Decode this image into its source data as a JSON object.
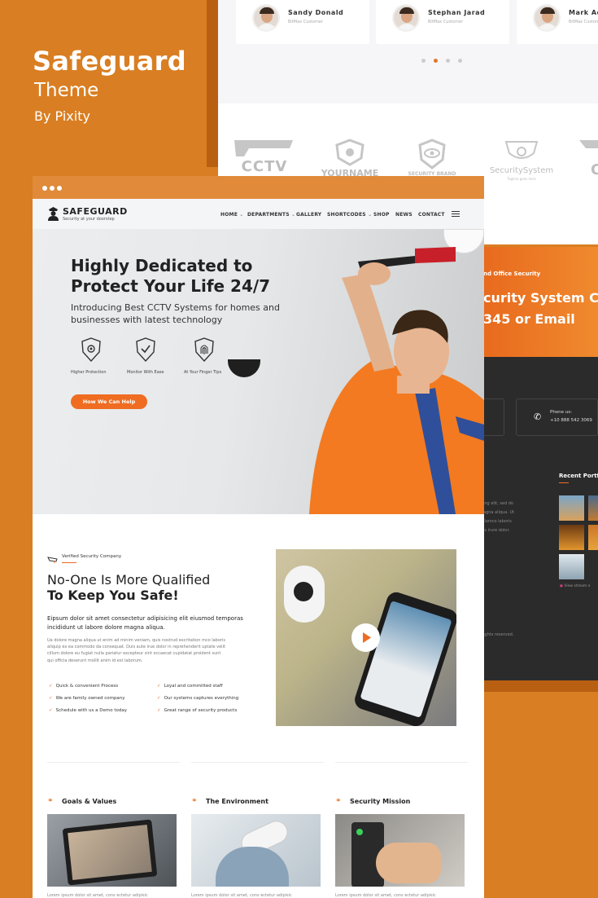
{
  "brand": {
    "title": "Safeguard",
    "subtitle": "Theme",
    "by": "By Pixity"
  },
  "testimonials": [
    {
      "name": "Sandy Donald",
      "role": "BitMax Customer"
    },
    {
      "name": "Stephan Jarad",
      "role": "BitMax Customer"
    },
    {
      "name": "Mark Ada",
      "role": "BitMax Customer"
    }
  ],
  "partner_logos": [
    "CCTV",
    "YOURNAME",
    "SECURITY BRAND",
    "SecuritySystem",
    "C"
  ],
  "partner_logo_sub": "Tagline goes here",
  "dark_panel": {
    "kicker": "nd Office Security",
    "headline1": "curity System Co",
    "headline2": "345 or Email",
    "phone_label": "Phone us:",
    "phone_number": "+10 888 542 3069",
    "recent": "Recent Portf",
    "body_lines": [
      "ing elit, sed do",
      "agna aliqua. Ut",
      "llamco laboris",
      "is irure dolor."
    ],
    "view_stream": "View stream o",
    "rights": "ights reserved."
  },
  "site": {
    "logo": "SAFEGUARD",
    "tagline": "Security at your doorstep",
    "nav": [
      "HOME",
      "DEPARTMENTS",
      "GALLERY",
      "SHORTCODES",
      "SHOP",
      "NEWS",
      "CONTACT"
    ]
  },
  "hero": {
    "title_line1": "Highly Dedicated to",
    "title_line2": "Protect Your Life 24/7",
    "desc_line1": "Introducing Best CCTV Systems for homes and",
    "desc_line2": "businesses with latest technology",
    "features": [
      "Higher Protection",
      "Monitor With Ease",
      "At Your Finger Tips"
    ],
    "button": "How We Can Help"
  },
  "about": {
    "kicker": "Verified Security Company",
    "title1": "No-One Is More Qualified",
    "title2": "To Keep You Safe!",
    "lead_line1": "Eipsum dolor sit amet consectetur adipisicing elit eiusmod temporas",
    "lead_line2": "incididunt ut labore dolore magna aliqua.",
    "body_lines": [
      "Ua dolore magna aliqua ut enim ad minim veniam, quis nostrud excritation mco laboris",
      "aliquip ex ea commodo da consequat. Duis aute irue dolor in reprehenderit uptate velit",
      "cillum dolore eu fugiat nulla pariatur excepteur sint occaecat cupidatat proident sunt",
      "qui officia deserunt mollit anim id est laborum."
    ],
    "checks_left": [
      "Quick & convenient Process",
      "We are family owned company",
      "Schedule with us a Demo today"
    ],
    "checks_right": [
      "Loyal and committed staff",
      "Our systems captures everything",
      "Great range of security products"
    ]
  },
  "cards": [
    {
      "title": "Goals & Values",
      "text": "Lorem ipsum dolor sit amet, cons ectetur adipisic"
    },
    {
      "title": "The Environment",
      "text": "Lorem ipsum dolor sit amet, cons ectetur adipisic"
    },
    {
      "title": "Security Mission",
      "text": "Lorem ipsum dolor sit amet, cons ectetur adipisic"
    }
  ]
}
